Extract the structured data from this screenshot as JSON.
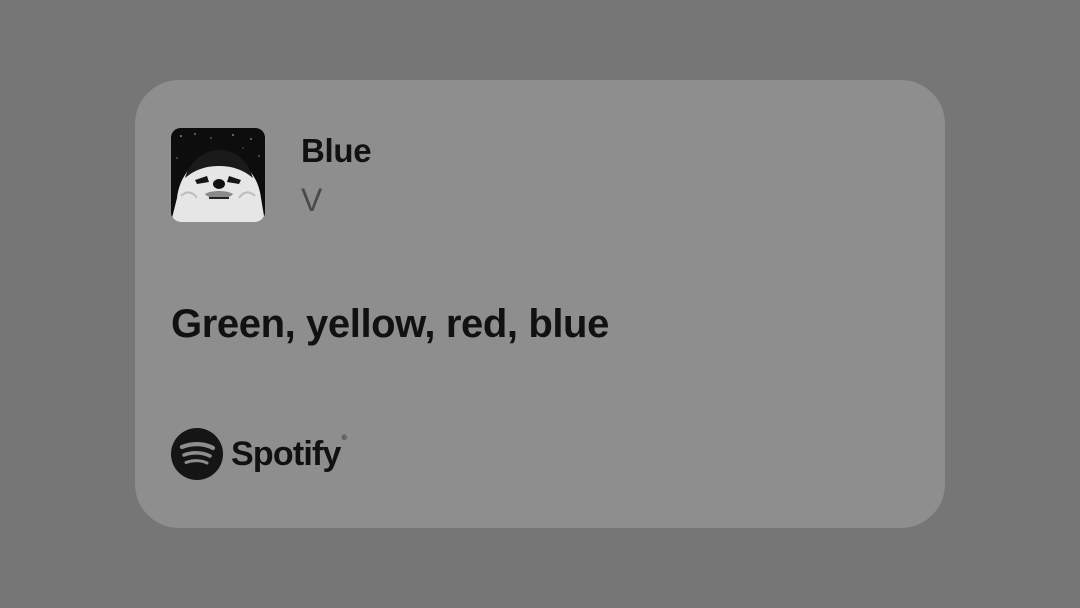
{
  "track": {
    "title": "Blue",
    "artist": "V",
    "cover_icon": "album-cover-image"
  },
  "lyric": {
    "line": "Green, yellow, red, blue"
  },
  "brand": {
    "name": "Spotify",
    "trademark": "®",
    "icon": "spotify-logo-icon"
  },
  "colors": {
    "background": "#767676",
    "card": "#8e8e8e",
    "text_primary": "#111111",
    "text_secondary": "#4a4a4a"
  }
}
